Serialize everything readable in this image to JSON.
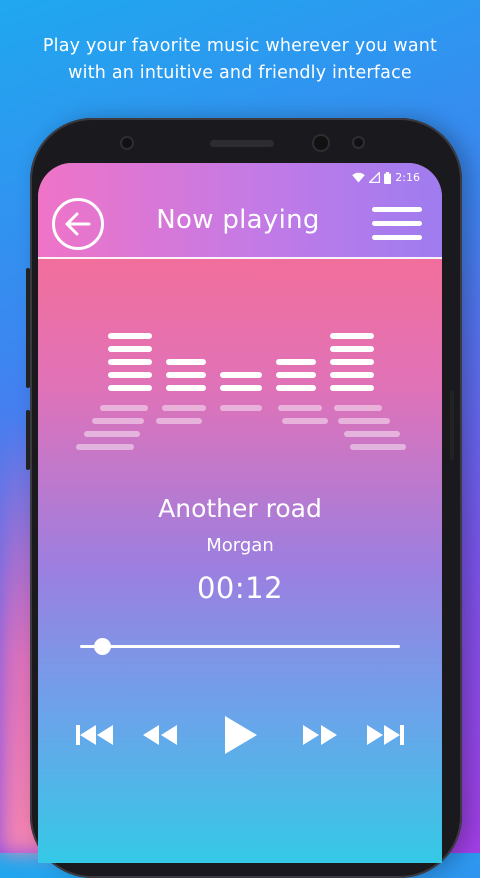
{
  "promo": {
    "line1": "Play your favorite music wherever you want",
    "line2": "with an intuitive and friendly interface"
  },
  "status": {
    "time": "2:16",
    "icons": [
      "wifi-icon",
      "signal-icon",
      "battery-icon"
    ]
  },
  "header": {
    "title": "Now playing",
    "back_icon": "arrow-left-icon",
    "menu_icon": "hamburger-menu-icon"
  },
  "track": {
    "title": "Another road",
    "artist": "Morgan",
    "elapsed": "00:12",
    "progress": 0.07
  },
  "controls": [
    "skip-previous-icon",
    "rewind-icon",
    "play-icon",
    "fast-forward-icon",
    "skip-next-icon"
  ],
  "colors": {
    "accent": "#ffffff",
    "top_gradient": "#ff6c86",
    "bottom_gradient": "#34c9e6"
  }
}
